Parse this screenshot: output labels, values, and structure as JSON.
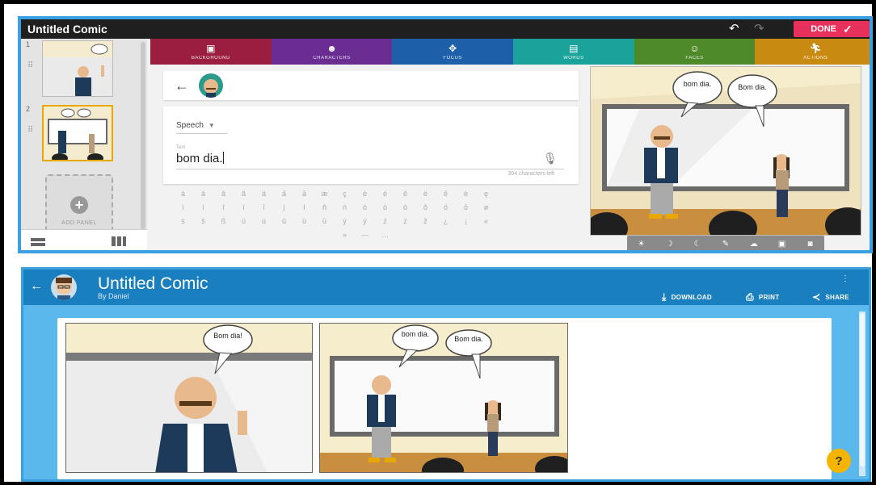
{
  "editor": {
    "title": "Untitled Comic",
    "undo_icon": "undo-icon",
    "redo_icon": "redo-icon",
    "done_label": "DONE",
    "tabs": [
      {
        "label": "BACKGROUND",
        "icon": "image-icon",
        "color": "#9b1e3e"
      },
      {
        "label": "CHARACTERS",
        "icon": "character-icon",
        "color": "#6a2d91"
      },
      {
        "label": "FOCUS",
        "icon": "focus-icon",
        "color": "#1d5fa8"
      },
      {
        "label": "WORDS",
        "icon": "speech-icon",
        "color": "#1aa39a"
      },
      {
        "label": "FACES",
        "icon": "face-icon",
        "color": "#4f8a2a"
      },
      {
        "label": "ACTIONS",
        "icon": "action-icon",
        "color": "#c98a12"
      }
    ],
    "sidebar": {
      "panel_numbers": [
        "1",
        "2"
      ],
      "add_panel_label": "ADD PANEL"
    },
    "words": {
      "bubble_type": "Speech",
      "text_label": "Text",
      "text_value": "bom dia.",
      "chars_left": "304 characters left"
    },
    "accents": [
      [
        "à",
        "á",
        "â",
        "ã",
        "ä",
        "å",
        "ā",
        "æ",
        "ç",
        "è",
        "é",
        "ê",
        "ë",
        "ē",
        "ė",
        "ę"
      ],
      [
        "ì",
        "í",
        "î",
        "ï",
        "ī",
        "į",
        "ł",
        "ñ",
        "ń",
        "ò",
        "ó",
        "ô",
        "õ",
        "ö",
        "ō",
        "ø"
      ],
      [
        "ś",
        "š",
        "ß",
        "ù",
        "ú",
        "û",
        "ü",
        "ū",
        "ý",
        "ÿ",
        "ź",
        "ż",
        "ž",
        "¿",
        "¡",
        "«"
      ],
      [
        "»",
        "—",
        "…"
      ]
    ],
    "canvas_bubbles": [
      "bom dia.",
      "Bom dia."
    ]
  },
  "viewer": {
    "title": "Untitled Comic",
    "author": "By Daniel",
    "actions": {
      "download": "DOWNLOAD",
      "print": "PRINT",
      "share": "SHARE"
    },
    "panel1_bubble": "Bom dia!",
    "panel2_bubbles": [
      "bom dia.",
      "Bom dia."
    ],
    "help": "?"
  },
  "colors": {
    "done": "#e8305d",
    "viewer_header": "#1a7fbf",
    "viewer_bg": "#5bb8ec",
    "help": "#f4b400"
  }
}
